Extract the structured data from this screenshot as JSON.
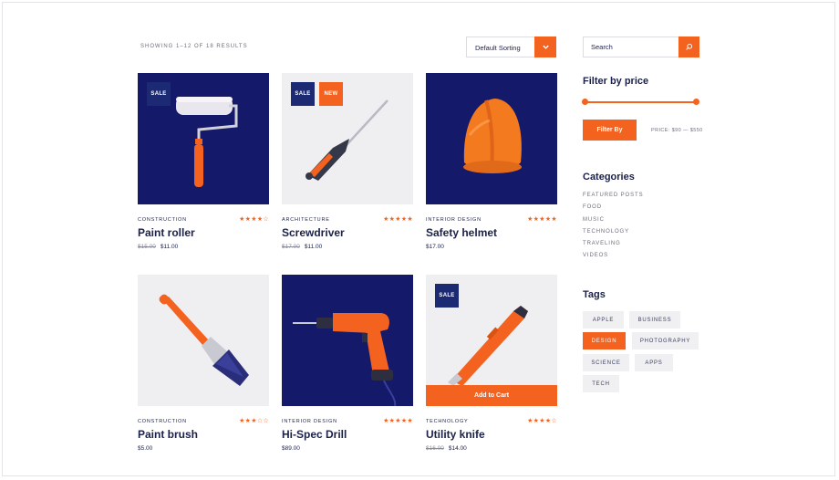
{
  "shop": {
    "results_text": "SHOWING 1–12 OF 18 RESULTS",
    "sort": {
      "selected": "Default Sorting"
    }
  },
  "products": [
    {
      "category": "CONSTRUCTION",
      "title": "Paint roller",
      "old_price": "$15.00",
      "price": "$11.00",
      "rating": 4,
      "stars": "★★★★☆",
      "badges": [
        "SALE"
      ],
      "image": "paint-roller",
      "bg": "navy"
    },
    {
      "category": "ARCHITECTURE",
      "title": "Screwdriver",
      "old_price": "$17.00",
      "price": "$11.00",
      "rating": 5,
      "stars": "★★★★★",
      "badges": [
        "SALE",
        "NEW"
      ],
      "image": "screwdriver",
      "bg": "light"
    },
    {
      "category": "INTERIOR DESIGN",
      "title": "Safety helmet",
      "old_price": "",
      "price": "$17.00",
      "rating": 5,
      "stars": "★★★★★",
      "badges": [],
      "image": "safety-helmet",
      "bg": "navy"
    },
    {
      "category": "CONSTRUCTION",
      "title": "Paint brush",
      "old_price": "",
      "price": "$5.00",
      "rating": 3,
      "stars": "★★★☆☆",
      "badges": [],
      "image": "paint-brush",
      "bg": "light"
    },
    {
      "category": "INTERIOR DESIGN",
      "title": "Hi-Spec Drill",
      "old_price": "",
      "price": "$89.00",
      "rating": 5,
      "stars": "★★★★★",
      "badges": [],
      "image": "power-drill",
      "bg": "navy"
    },
    {
      "category": "TECHNOLOGY",
      "title": "Utility knife",
      "old_price": "$16.00",
      "price": "$14.00",
      "rating": 4,
      "stars": "★★★★☆",
      "badges": [
        "SALE"
      ],
      "image": "utility-knife",
      "bg": "light",
      "add_to_cart": "Add to Cart"
    }
  ],
  "sidebar": {
    "search": {
      "placeholder": "Search"
    },
    "filter": {
      "title": "Filter by price",
      "button": "Filter By",
      "range_text": "PRICE: $90 — $550"
    },
    "categories": {
      "title": "Categories",
      "items": [
        "FEATURED POSTS",
        "FOOD",
        "MUSIC",
        "TECHNOLOGY",
        "TRAVELING",
        "VIDEOS"
      ]
    },
    "tags": {
      "title": "Tags",
      "items": [
        "APPLE",
        "BUSINESS",
        "DESIGN",
        "PHOTOGRAPHY",
        "SCIENCE",
        "APPS",
        "TECH"
      ],
      "active": "DESIGN"
    }
  },
  "colors": {
    "accent": "#f4621f",
    "navy": "#14196a",
    "text": "#1b2148",
    "light_bg": "#efeff2"
  },
  "icons": {
    "sort": "chevron-down-icon",
    "search": "search-icon",
    "star": "star-icon"
  }
}
